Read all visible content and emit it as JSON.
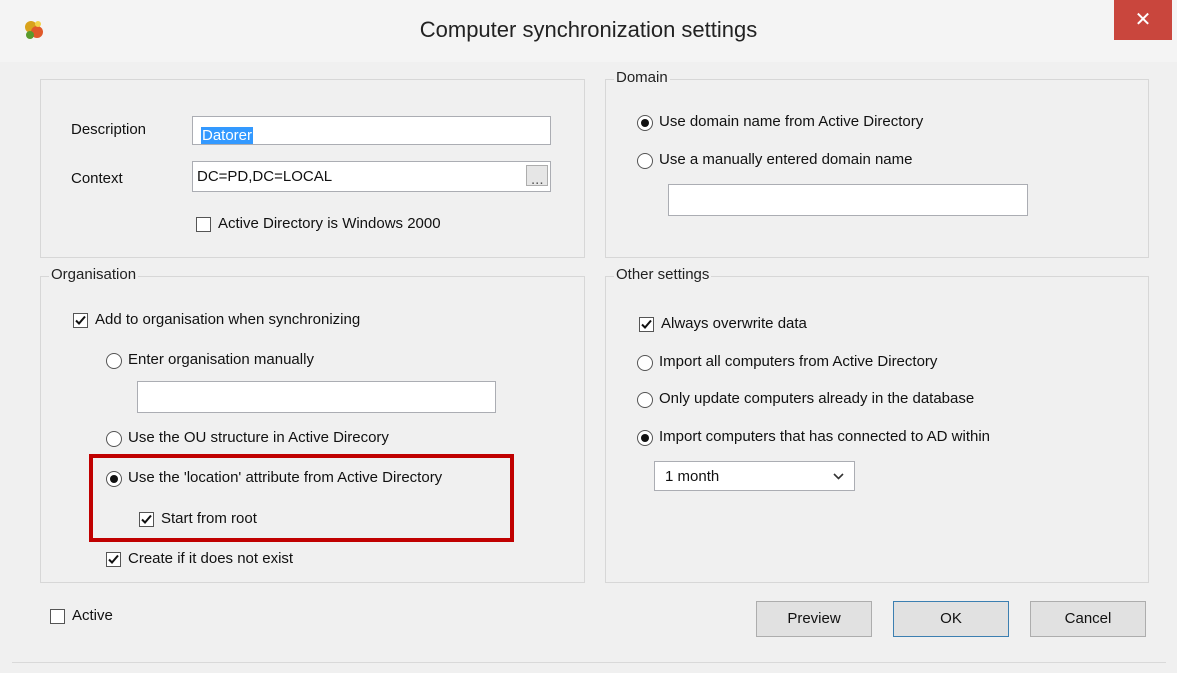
{
  "window": {
    "title": "Computer synchronization settings",
    "close_symbol": "✕"
  },
  "general": {
    "description_label": "Description",
    "description_value": "Datorer",
    "context_label": "Context",
    "context_value": "DC=PD,DC=LOCAL",
    "browse_label": "...",
    "win2000_label": "Active Directory is Windows 2000",
    "win2000_checked": false
  },
  "domain": {
    "legend": "Domain",
    "use_ad_label": "Use domain name from Active Directory",
    "use_ad_selected": true,
    "manual_label": "Use a manually entered domain name",
    "manual_selected": false,
    "manual_value": ""
  },
  "organisation": {
    "legend": "Organisation",
    "add_label": "Add to organisation when synchronizing",
    "add_checked": true,
    "manual_label": "Enter organisation manually",
    "manual_value": "",
    "ou_label": "Use the OU structure in Active Direcory",
    "location_label": "Use the 'location' attribute from Active Directory",
    "location_selected": true,
    "start_root_label": "Start from root",
    "start_root_checked": true,
    "create_label": "Create if it does not exist",
    "create_checked": true
  },
  "other": {
    "legend": "Other settings",
    "overwrite_label": "Always overwrite data",
    "overwrite_checked": true,
    "import_all_label": "Import all computers from Active Directory",
    "only_update_label": "Only update computers already in the database",
    "import_connected_label": "Import computers that has connected to AD within",
    "import_connected_selected": true,
    "period_value": "1 month"
  },
  "footer": {
    "active_label": "Active",
    "active_checked": false,
    "preview_label": "Preview",
    "ok_label": "OK",
    "cancel_label": "Cancel"
  },
  "colors": {
    "highlight_border": "#c00000",
    "close_button": "#c9463d",
    "selection": "#3399ff"
  }
}
